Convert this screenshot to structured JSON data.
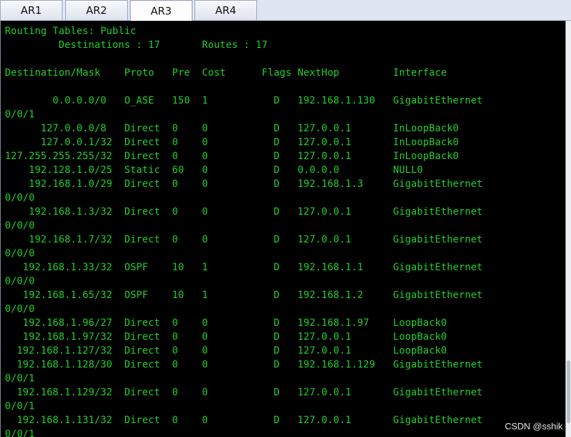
{
  "tabs": [
    {
      "label": "AR1"
    },
    {
      "label": "AR2"
    },
    {
      "label": "AR3"
    },
    {
      "label": "AR4"
    }
  ],
  "active_tab": "AR3",
  "terminal": {
    "lines": [
      "Routing Tables: Public",
      "         Destinations : 17       Routes : 17",
      "",
      "Destination/Mask    Proto   Pre  Cost      Flags NextHop         Interface",
      "",
      "        0.0.0.0/0   O_ASE   150  1           D   192.168.1.130   GigabitEthernet",
      "0/0/1",
      "      127.0.0.0/8   Direct  0    0           D   127.0.0.1       InLoopBack0",
      "      127.0.0.1/32  Direct  0    0           D   127.0.0.1       InLoopBack0",
      "127.255.255.255/32  Direct  0    0           D   127.0.0.1       InLoopBack0",
      "    192.128.1.0/25  Static  60   0           D   0.0.0.0         NULL0",
      "    192.168.1.0/29  Direct  0    0           D   192.168.1.3     GigabitEthernet",
      "0/0/0",
      "    192.168.1.3/32  Direct  0    0           D   127.0.0.1       GigabitEthernet",
      "0/0/0",
      "    192.168.1.7/32  Direct  0    0           D   127.0.0.1       GigabitEthernet",
      "0/0/0",
      "   192.168.1.33/32  OSPF    10   1           D   192.168.1.1     GigabitEthernet",
      "0/0/0",
      "   192.168.1.65/32  OSPF    10   1           D   192.168.1.2     GigabitEthernet",
      "0/0/0",
      "   192.168.1.96/27  Direct  0    0           D   192.168.1.97    LoopBack0",
      "   192.168.1.97/32  Direct  0    0           D   127.0.0.1       LoopBack0",
      "  192.168.1.127/32  Direct  0    0           D   127.0.0.1       LoopBack0",
      "  192.168.1.128/30  Direct  0    0           D   192.168.1.129   GigabitEthernet",
      "0/0/1",
      "  192.168.1.129/32  Direct  0    0           D   127.0.0.1       GigabitEthernet",
      "0/0/1",
      "  192.168.1.131/32  Direct  0    0           D   127.0.0.1       GigabitEthernet",
      "0/0/1"
    ]
  },
  "watermark": "CSDN @sshik",
  "colors": {
    "terminal_bg": "#000000",
    "terminal_fg": "#21d12a"
  }
}
